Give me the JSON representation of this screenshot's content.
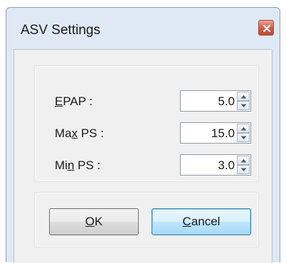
{
  "window": {
    "title": "ASV Settings"
  },
  "fields": [
    {
      "label_pre": "",
      "label_key": "E",
      "label_post": "PAP :",
      "value": "5.0"
    },
    {
      "label_pre": "Ma",
      "label_key": "x",
      "label_post": " PS :",
      "value": "15.0"
    },
    {
      "label_pre": "Mi",
      "label_key": "n",
      "label_post": " PS :",
      "value": "3.0"
    }
  ],
  "buttons": {
    "ok_pre": "",
    "ok_key": "O",
    "ok_post": "K",
    "cancel_pre": "",
    "cancel_key": "C",
    "cancel_post": "ancel"
  },
  "icons": {
    "close": "close-icon",
    "spin_up": "spin-up-arrow-icon",
    "spin_down": "spin-down-arrow-icon"
  },
  "colors": {
    "titlebar": "#dfe9f5",
    "close_button": "#cf5a45",
    "client": "#f0f0f0",
    "focus_border": "#3c7fb1"
  }
}
